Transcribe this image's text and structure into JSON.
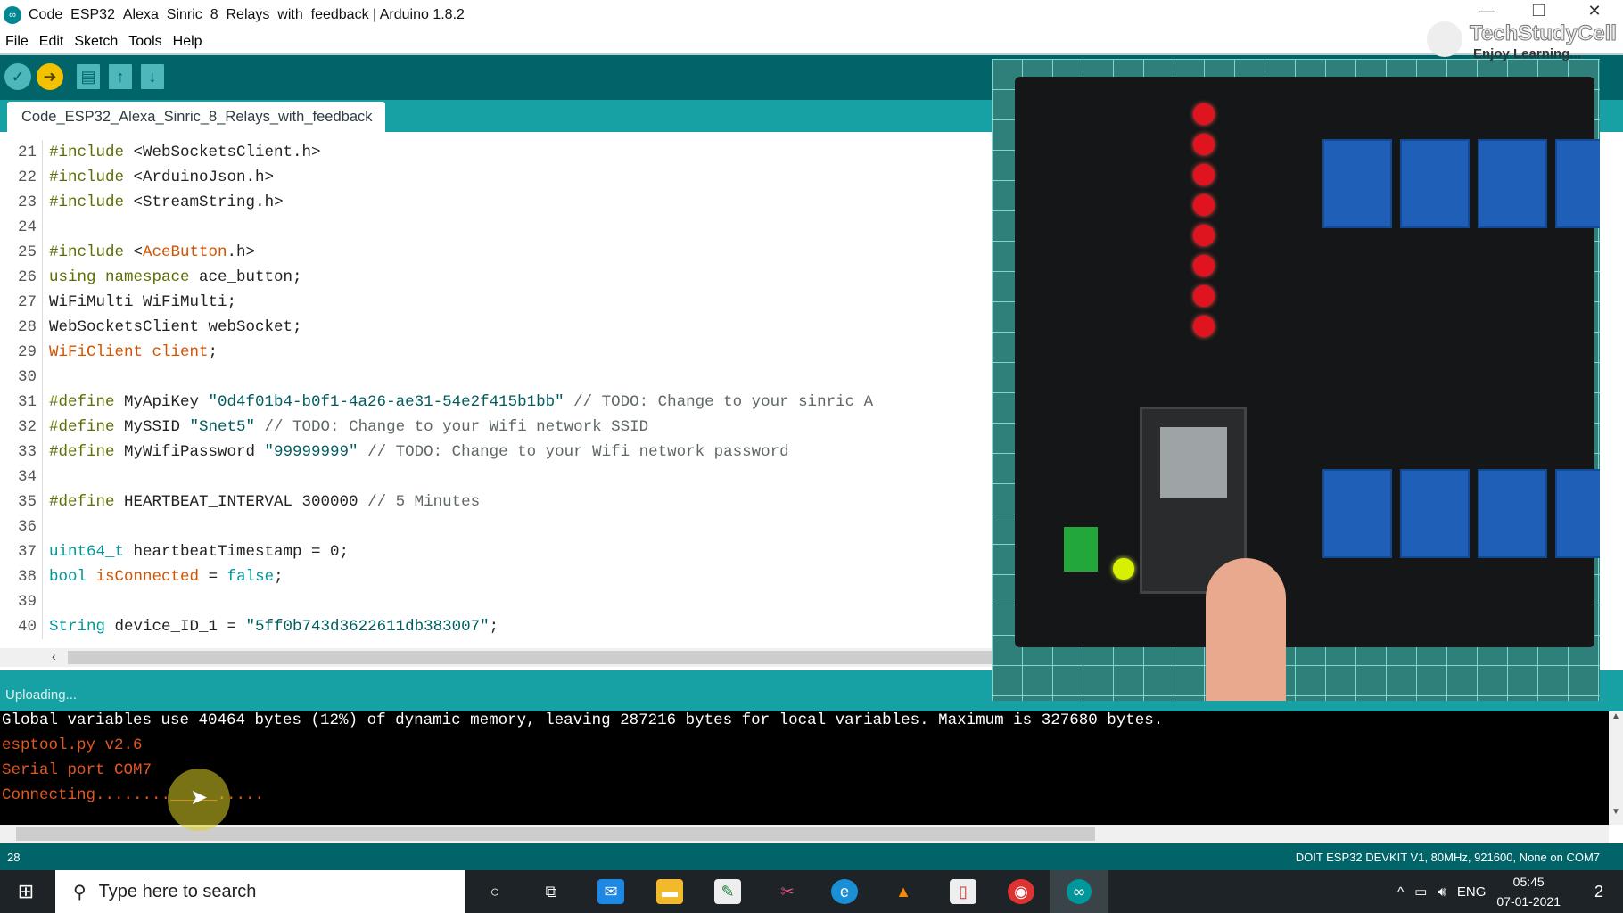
{
  "window": {
    "title": "Code_ESP32_Alexa_Sinric_8_Relays_with_feedback | Arduino 1.8.2"
  },
  "menu": [
    "File",
    "Edit",
    "Sketch",
    "Tools",
    "Help"
  ],
  "toolbar": {
    "verify": "verify-icon",
    "upload": "upload-icon",
    "new": "new-icon",
    "open": "open-icon",
    "save": "save-icon"
  },
  "tab": {
    "label": "Code_ESP32_Alexa_Sinric_8_Relays_with_feedback"
  },
  "editor": {
    "lines": [
      {
        "n": "21",
        "t": [
          [
            "#include ",
            "kw"
          ],
          [
            "<WebSocketsClient.h>",
            ""
          ]
        ]
      },
      {
        "n": "22",
        "t": [
          [
            "#include ",
            "kw"
          ],
          [
            "<ArduinoJson.h>",
            ""
          ]
        ]
      },
      {
        "n": "23",
        "t": [
          [
            "#include ",
            "kw"
          ],
          [
            "<",
            ""
          ],
          [
            "StreamString",
            ""
          ],
          [
            ".h>",
            ""
          ]
        ]
      },
      {
        "n": "24",
        "t": []
      },
      {
        "n": "25",
        "t": [
          [
            "#include ",
            "kw"
          ],
          [
            "<",
            ""
          ],
          [
            "AceButton",
            "lib"
          ],
          [
            ".h>",
            ""
          ]
        ]
      },
      {
        "n": "26",
        "t": [
          [
            "using namespace ",
            "kw"
          ],
          [
            "ace_button;",
            ""
          ]
        ]
      },
      {
        "n": "27",
        "t": [
          [
            "WiFiMulti WiFiMulti;",
            ""
          ]
        ]
      },
      {
        "n": "28",
        "t": [
          [
            "WebSocketsClient webSocket;",
            ""
          ]
        ]
      },
      {
        "n": "29",
        "t": [
          [
            "WiFiClient client",
            "lib"
          ],
          [
            ";",
            ""
          ]
        ]
      },
      {
        "n": "30",
        "t": []
      },
      {
        "n": "31",
        "t": [
          [
            "#define ",
            "kw"
          ],
          [
            "MyApiKey ",
            ""
          ],
          [
            "\"0d4f01b4-b0f1-4a26-ae31-54e2f415b1bb\"",
            "str"
          ],
          [
            " // TODO: Change to your sinric A",
            "cm"
          ]
        ]
      },
      {
        "n": "32",
        "t": [
          [
            "#define ",
            "kw"
          ],
          [
            "MySSID ",
            ""
          ],
          [
            "\"Snet5\"",
            "str"
          ],
          [
            " // TODO: Change to your Wifi network SSID",
            "cm"
          ]
        ]
      },
      {
        "n": "33",
        "t": [
          [
            "#define ",
            "kw"
          ],
          [
            "MyWifiPassword ",
            ""
          ],
          [
            "\"99999999\"",
            "str"
          ],
          [
            " // TODO: Change to your Wifi network password",
            "cm"
          ]
        ]
      },
      {
        "n": "34",
        "t": []
      },
      {
        "n": "35",
        "t": [
          [
            "#define ",
            "kw"
          ],
          [
            "HEARTBEAT_INTERVAL 300000 ",
            ""
          ],
          [
            "// 5 Minutes",
            "cm"
          ]
        ]
      },
      {
        "n": "36",
        "t": []
      },
      {
        "n": "37",
        "t": [
          [
            "uint64_t",
            "ty"
          ],
          [
            " heartbeatTimestamp = 0;",
            ""
          ]
        ]
      },
      {
        "n": "38",
        "t": [
          [
            "bool",
            "ty"
          ],
          [
            " ",
            ""
          ],
          [
            "isConnected",
            "lib"
          ],
          [
            " = ",
            ""
          ],
          [
            "false",
            "ty"
          ],
          [
            ";",
            ""
          ]
        ]
      },
      {
        "n": "39",
        "t": []
      },
      {
        "n": "40",
        "t": [
          [
            "String",
            "ty"
          ],
          [
            " device_ID_1 = ",
            ""
          ],
          [
            "\"5ff0b743d3622611db383007\"",
            "str"
          ],
          [
            ";",
            ""
          ]
        ]
      }
    ]
  },
  "status": {
    "message": "Uploading..."
  },
  "console": {
    "lines": [
      {
        "text": "Global variables use 40464 bytes (12%) of dynamic memory, leaving 287216 bytes for local variables. Maximum is 327680 bytes.",
        "c": "white"
      },
      {
        "text": "esptool.py v2.6",
        "c": "orange"
      },
      {
        "text": "Serial port COM7",
        "c": "orange"
      },
      {
        "text": "Connecting........_____.....",
        "c": "orange"
      }
    ]
  },
  "bottombar": {
    "line": "28",
    "board": "DOIT ESP32 DEVKIT V1, 80MHz, 921600, None on COM7"
  },
  "taskbar": {
    "search_placeholder": "Type here to search",
    "language": "ENG",
    "time": "05:45",
    "date": "07-01-2021",
    "notifications": "2"
  },
  "watermark": {
    "brand": "TechStudyCell",
    "tagline": "Enjoy Learning..."
  },
  "colors": {
    "teal_dark": "#006468",
    "teal": "#17a1a5",
    "upload_yellow": "#f2c200"
  }
}
